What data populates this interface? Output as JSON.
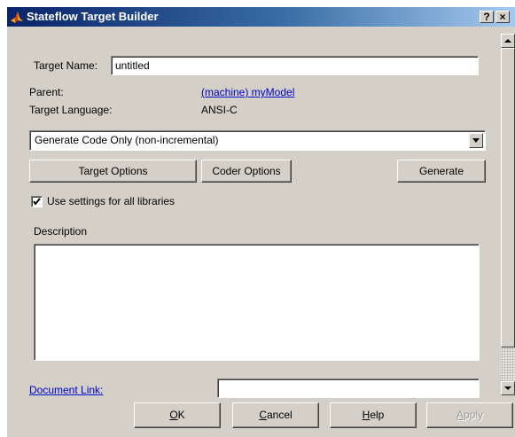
{
  "window": {
    "title": "Stateflow Target Builder",
    "help_button": "?",
    "close_button": "×"
  },
  "form": {
    "target_name_label": "Target Name:",
    "target_name_value": "untitled",
    "parent_label": "Parent:",
    "parent_link": "(machine) myModel",
    "target_language_label": "Target Language:",
    "target_language_value": "ANSI-C",
    "mode_select_value": "Generate Code Only (non-incremental)",
    "target_options_label": "Target Options",
    "coder_options_label": "Coder Options",
    "generate_label": "Generate",
    "use_settings_label": "Use settings for all libraries",
    "use_settings_checked": true,
    "description_label": "Description",
    "description_value": "",
    "document_link_label": "Document Link:",
    "document_link_value": ""
  },
  "footer": {
    "ok": {
      "mnemonic": "O",
      "rest": "K"
    },
    "cancel": {
      "mnemonic": "C",
      "rest": "ancel"
    },
    "help": {
      "mnemonic": "H",
      "rest": "elp"
    },
    "apply": {
      "mnemonic": "A",
      "rest": "pply",
      "enabled": false
    }
  },
  "colors": {
    "titlebar_start": "#0a246a",
    "titlebar_end": "#a6caf0",
    "dialog_bg": "#d4d0c8",
    "link": "#0000cc"
  },
  "icons": {
    "app": "stateflow-logo-icon",
    "checkbox": "checkmark-icon",
    "dropdown": "triangle-down-icon",
    "scroll_up": "triangle-up-icon",
    "scroll_down": "triangle-down-icon"
  }
}
